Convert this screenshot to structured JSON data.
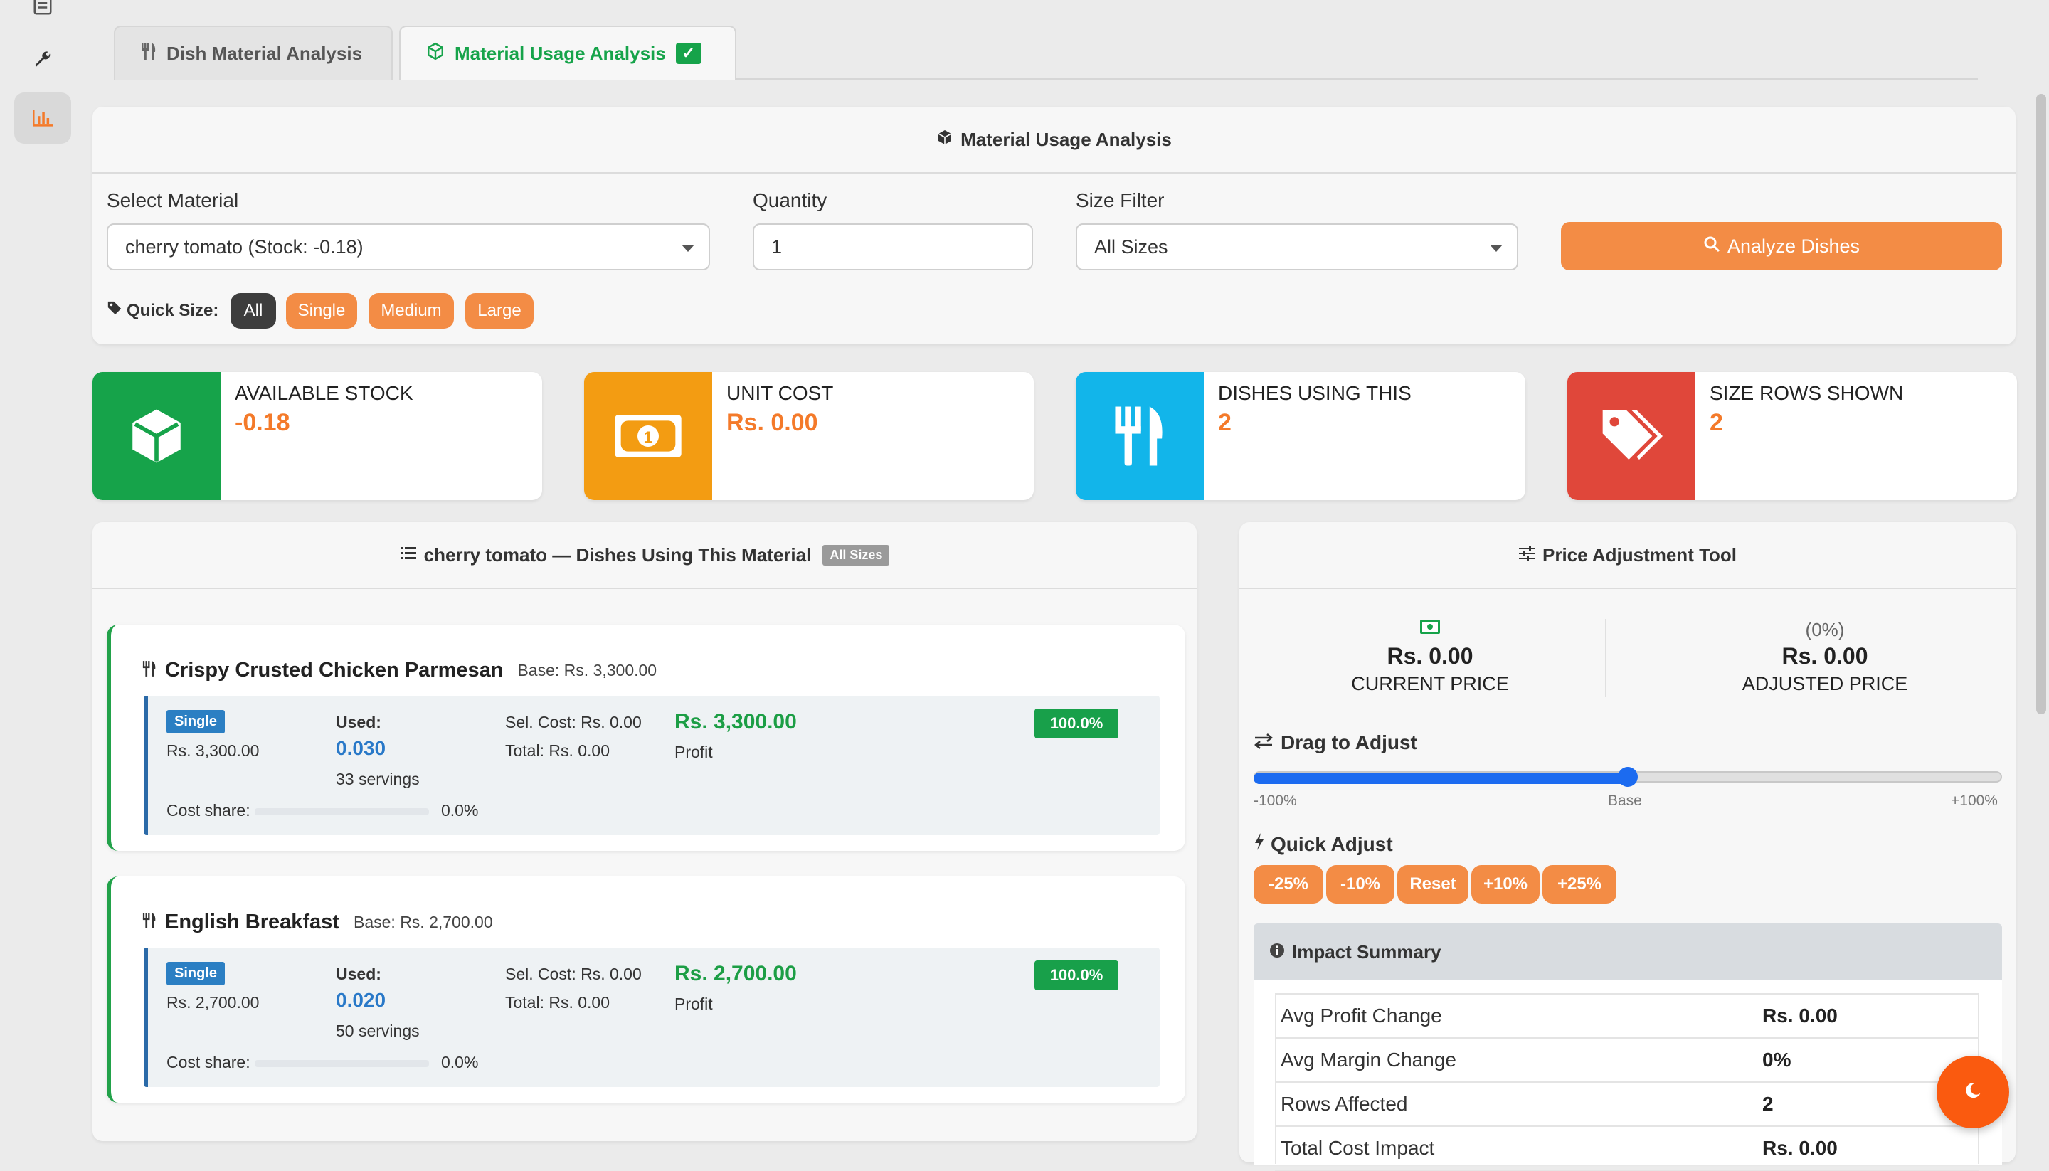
{
  "rail": {
    "icons": [
      "list-icon",
      "wrench-icon",
      "chart-icon"
    ]
  },
  "tabs": [
    {
      "label": "Dish Material Analysis",
      "icon": "utensils-icon"
    },
    {
      "label": "Material Usage Analysis",
      "icon": "cube-icon",
      "check": "✓"
    }
  ],
  "filter_card": {
    "title": "Material Usage Analysis",
    "select_material_label": "Select Material",
    "select_material_value": "cherry tomato (Stock: -0.18)",
    "quantity_label": "Quantity",
    "quantity_value": "1",
    "size_filter_label": "Size Filter",
    "size_filter_value": "All Sizes",
    "analyze_button": "Analyze Dishes",
    "quick_size_label": "Quick Size:",
    "quick_sizes": [
      "All",
      "Single",
      "Medium",
      "Large"
    ]
  },
  "stats": [
    {
      "label": "AVAILABLE STOCK",
      "value": "-0.18",
      "color": "#16a34a",
      "icon": "cube-icon"
    },
    {
      "label": "UNIT COST",
      "value": "Rs. 0.00",
      "color": "#f39c12",
      "icon": "money-bill-icon"
    },
    {
      "label": "DISHES USING THIS",
      "value": "2",
      "color": "#12b5ea",
      "icon": "utensils-icon"
    },
    {
      "label": "SIZE ROWS SHOWN",
      "value": "2",
      "color": "#e0473a",
      "icon": "tags-icon"
    }
  ],
  "dishes_panel": {
    "title": "cherry tomato — Dishes Using This Material",
    "badge": "All Sizes",
    "dishes": [
      {
        "name": "Crispy Crusted Chicken Parmesan",
        "base": "Base: Rs. 3,300.00",
        "size": "Single",
        "size_price": "Rs. 3,300.00",
        "used_label": "Used:",
        "used_value": "0.030",
        "servings": "33 servings",
        "sel_cost": "Sel. Cost: Rs. 0.00",
        "total": "Total: Rs. 0.00",
        "profit": "Rs. 3,300.00",
        "profit_label": "Profit",
        "margin": "100.0%",
        "cost_share_label": "Cost share:",
        "cost_share": "0.0%"
      },
      {
        "name": "English Breakfast",
        "base": "Base: Rs. 2,700.00",
        "size": "Single",
        "size_price": "Rs. 2,700.00",
        "used_label": "Used:",
        "used_value": "0.020",
        "servings": "50 servings",
        "sel_cost": "Sel. Cost: Rs. 0.00",
        "total": "Total: Rs. 0.00",
        "profit": "Rs. 2,700.00",
        "profit_label": "Profit",
        "margin": "100.0%",
        "cost_share_label": "Cost share:",
        "cost_share": "0.0%"
      }
    ]
  },
  "price_tool": {
    "title": "Price Adjustment Tool",
    "current_price": "Rs. 0.00",
    "current_label": "CURRENT PRICE",
    "adjusted_pct": "(0%)",
    "adjusted_price": "Rs. 0.00",
    "adjusted_label": "ADJUSTED PRICE",
    "drag_label": "Drag to Adjust",
    "slider_min": "-100%",
    "slider_mid": "Base",
    "slider_max": "+100%",
    "slider_value_fraction": 0.5,
    "quick_adjust_label": "Quick Adjust",
    "quick_buttons": [
      "-25%",
      "-10%",
      "Reset",
      "+10%",
      "+25%"
    ],
    "impact_title": "Impact Summary",
    "impact_rows": [
      {
        "label": "Avg Profit Change",
        "value": "Rs. 0.00"
      },
      {
        "label": "Avg Margin Change",
        "value": "0%"
      },
      {
        "label": "Rows Affected",
        "value": "2"
      },
      {
        "label": "Total Cost Impact",
        "value": "Rs. 0.00"
      }
    ]
  },
  "colors": {
    "accent": "#f47a2a",
    "success": "#16a34a",
    "info": "#2979c8"
  }
}
